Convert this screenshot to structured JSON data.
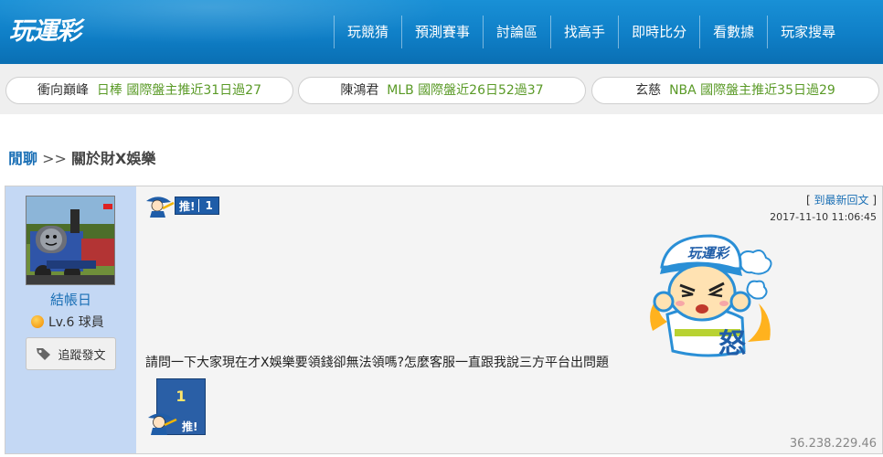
{
  "header": {
    "logo_text": "玩運彩",
    "nav": [
      "玩競猜",
      "預測賽事",
      "討論區",
      "找高手",
      "即時比分",
      "看數據",
      "玩家搜尋"
    ]
  },
  "ticker": [
    {
      "name": "衝向巔峰",
      "text": "日棒 國際盤主推近31日過27"
    },
    {
      "name": "陳鴻君",
      "text": "MLB 國際盤近26日52過37"
    },
    {
      "name": "玄慈",
      "text": "NBA 國際盤主推近35日過29"
    }
  ],
  "breadcrumb": {
    "home": "閒聊",
    "separator": " >> ",
    "current": "關於財X娛樂"
  },
  "post": {
    "author": {
      "username": "結帳日",
      "level": "Lv.6 球員",
      "track_button": "追蹤發文"
    },
    "push_label": "推!",
    "push_count": "1",
    "reply_link_open": "[ ",
    "reply_link": "到最新回文",
    "reply_link_close": " ]",
    "timestamp": "2017-11-10 11:06:45",
    "sticker_text": "玩運彩",
    "sticker_emotion": "怒",
    "content": "請問一下大家現在才X娛樂要領錢卻無法領嗎?怎麼客服一直跟我說三方平台出問題",
    "ip": "36.238.229.46"
  },
  "colors": {
    "header_blue": "#1088d0",
    "link_blue": "#1a6fb5",
    "ticker_green": "#5a9a27",
    "author_bg": "#c4d8f4",
    "push_blue": "#1f5da8"
  }
}
